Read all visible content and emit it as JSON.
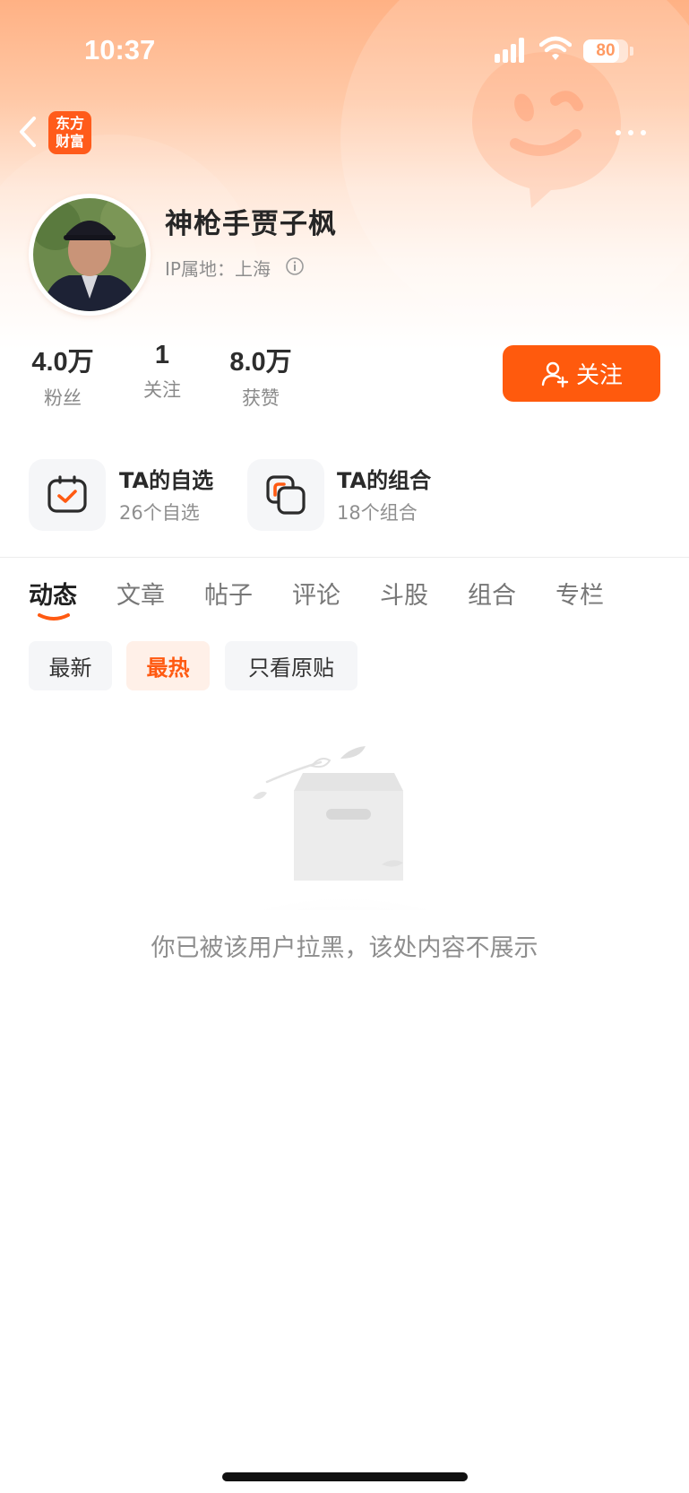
{
  "status_bar": {
    "time": "10:37",
    "battery_percent": 80,
    "battery_label": "80"
  },
  "nav": {
    "app_logo_line1": "东方",
    "app_logo_line2": "财富"
  },
  "profile": {
    "username": "神枪手贾子枫",
    "ip_location": "IP属地：上海",
    "stats": [
      {
        "value": "4.0万",
        "label": "粉丝"
      },
      {
        "value": "1",
        "label": "关注"
      },
      {
        "value": "8.0万",
        "label": "获赞"
      }
    ],
    "follow_label": "关注"
  },
  "selections": [
    {
      "title": "TA的自选",
      "subtitle": "26个自选",
      "icon": "watchlist-check-icon"
    },
    {
      "title": "TA的组合",
      "subtitle": "18个组合",
      "icon": "portfolio-icon"
    }
  ],
  "tabs": [
    "动态",
    "文章",
    "帖子",
    "评论",
    "斗股",
    "组合",
    "专栏"
  ],
  "active_tab": "动态",
  "filters": [
    "最新",
    "最热",
    "只看原贴"
  ],
  "active_filter": "最热",
  "empty_state": {
    "message": "你已被该用户拉黑，该处内容不展示",
    "icon": "empty-box-icon"
  },
  "colors": {
    "accent": "#ff5a0d",
    "header_top": "#ffb184"
  }
}
